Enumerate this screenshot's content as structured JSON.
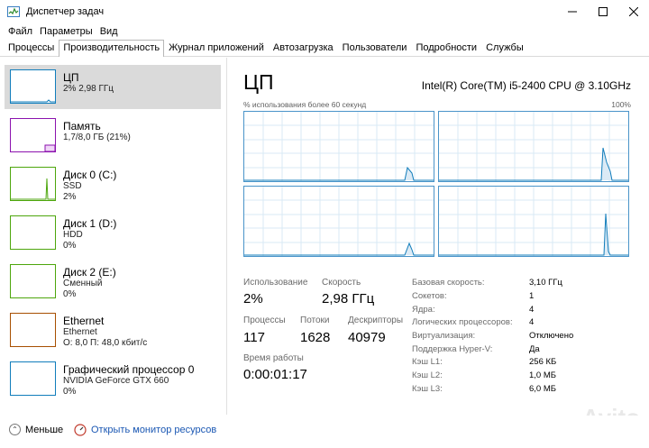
{
  "window": {
    "title": "Диспетчер задач"
  },
  "menu": [
    "Файл",
    "Параметры",
    "Вид"
  ],
  "tabs": [
    "Процессы",
    "Производительность",
    "Журнал приложений",
    "Автозагрузка",
    "Пользователи",
    "Подробности",
    "Службы"
  ],
  "active_tab": 1,
  "sidebar": {
    "items": [
      {
        "title": "ЦП",
        "sub1": "2% 2,98 ГГц",
        "sub2": "",
        "color": "#117dbb"
      },
      {
        "title": "Память",
        "sub1": "1,7/8,0 ГБ (21%)",
        "sub2": "",
        "color": "#8b12ae"
      },
      {
        "title": "Диск 0 (C:)",
        "sub1": "SSD",
        "sub2": "2%",
        "color": "#4da60c"
      },
      {
        "title": "Диск 1 (D:)",
        "sub1": "HDD",
        "sub2": "0%",
        "color": "#4da60c"
      },
      {
        "title": "Диск 2 (E:)",
        "sub1": "Сменный",
        "sub2": "0%",
        "color": "#4da60c"
      },
      {
        "title": "Ethernet",
        "sub1": "Ethernet",
        "sub2": "О: 8,0  П: 48,0 кбит/с",
        "color": "#a74f01"
      },
      {
        "title": "Графический процессор 0",
        "sub1": "NVIDIA GeForce GTX 660",
        "sub2": "0%",
        "color": "#117dbb"
      }
    ]
  },
  "main": {
    "title": "ЦП",
    "cpu_model": "Intel(R) Core(TM) i5-2400 CPU @ 3.10GHz",
    "graph_label": "% использования более 60 секунд",
    "graph_max": "100%",
    "stats": {
      "usage_label": "Использование",
      "usage_value": "2%",
      "speed_label": "Скорость",
      "speed_value": "2,98 ГГц",
      "processes_label": "Процессы",
      "processes_value": "117",
      "threads_label": "Потоки",
      "threads_value": "1628",
      "handles_label": "Дескрипторы",
      "handles_value": "40979",
      "uptime_label": "Время работы",
      "uptime_value": "0:00:01:17"
    },
    "info": [
      {
        "label": "Базовая скорость:",
        "value": "3,10 ГГц"
      },
      {
        "label": "Сокетов:",
        "value": "1"
      },
      {
        "label": "Ядра:",
        "value": "4"
      },
      {
        "label": "Логических процессоров:",
        "value": "4"
      },
      {
        "label": "Виртуализация:",
        "value": "Отключено"
      },
      {
        "label": "Поддержка Hyper-V:",
        "value": "Да"
      },
      {
        "label": "Кэш L1:",
        "value": "256 КБ"
      },
      {
        "label": "Кэш L2:",
        "value": "1,0 МБ"
      },
      {
        "label": "Кэш L3:",
        "value": "6,0 МБ"
      }
    ]
  },
  "footer": {
    "less": "Меньше",
    "link": "Открыть монитор ресурсов"
  },
  "watermark": "Avito",
  "colors": {
    "cpu": "#117dbb",
    "graph_border": "#4a94c9",
    "grid": "#d9eaf4",
    "link": "#1a57b3"
  }
}
